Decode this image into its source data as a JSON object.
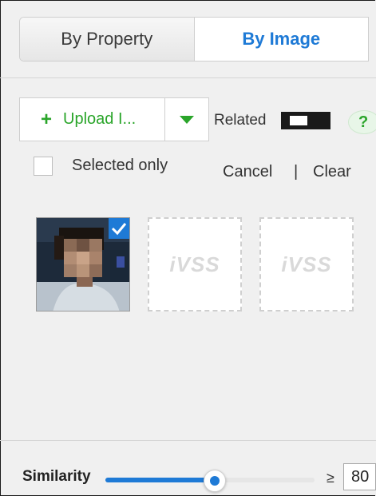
{
  "tabs": [
    {
      "label": "By Property",
      "active": false
    },
    {
      "label": "By Image",
      "active": true
    }
  ],
  "upload": {
    "label": "Upload I...",
    "plus": "+",
    "dropdown_icon": "triangle-down-icon"
  },
  "related": {
    "label": "Related",
    "enabled": false
  },
  "help": {
    "label": "?"
  },
  "selected_only": {
    "label": "Selected only",
    "checked": false
  },
  "actions": {
    "cancel": "Cancel",
    "separator": "|",
    "clear": "Clear"
  },
  "images": [
    {
      "type": "photo",
      "selected": true
    },
    {
      "type": "placeholder",
      "watermark": "iVSS"
    },
    {
      "type": "placeholder",
      "watermark": "iVSS"
    }
  ],
  "similarity": {
    "label": "Similarity",
    "value": "80",
    "operator": "≥",
    "fraction": 0.52
  },
  "colors": {
    "accent": "#1e7ad6",
    "green": "#2aa52a"
  }
}
